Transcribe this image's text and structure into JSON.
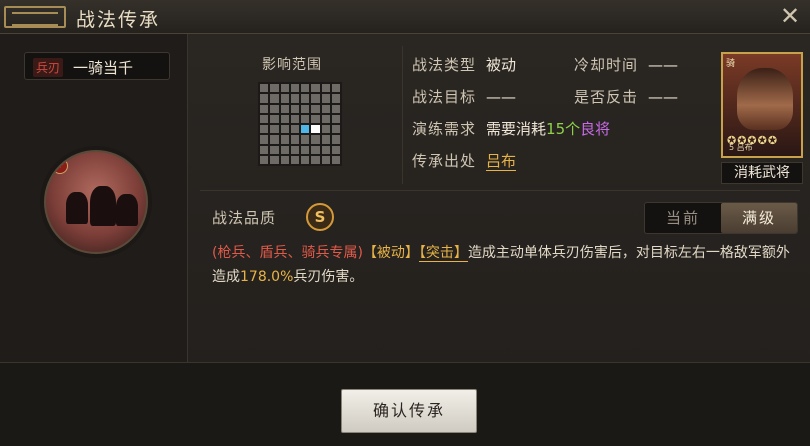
{
  "window": {
    "title": "战法传承",
    "close_glyph": "✕"
  },
  "skill": {
    "type_badge": "兵刃",
    "name": "一骑当千"
  },
  "range": {
    "label": "影响范围",
    "grid_rows": 8,
    "grid_cols": 8,
    "self_cell": [
      4,
      5
    ],
    "hit_cells": [
      [
        4,
        4
      ]
    ]
  },
  "info": {
    "type_label": "战法类型",
    "type_value": "被动",
    "cooldown_label": "冷却时间",
    "cooldown_value": "——",
    "target_label": "战法目标",
    "target_value": "——",
    "counter_label": "是否反击",
    "counter_value": "——",
    "train_label": "演练需求",
    "train_prefix": "需要消耗",
    "train_count": "15个",
    "train_item": "良将",
    "origin_label": "传承出处",
    "origin_value": "吕布"
  },
  "card": {
    "caption": "消耗武将",
    "stars": "✪✪✪✪✪",
    "corner_text": "骑",
    "mini_text": "5   吕布"
  },
  "quality": {
    "label": "战法品质",
    "grade": "S"
  },
  "toggle": {
    "current_label": "当前",
    "max_label": "满级",
    "selected": "max"
  },
  "description": {
    "restriction": "(枪兵、盾兵、骑兵专属)",
    "tag_passive": "【被动】",
    "tag_burst": "【突击】",
    "text_1": "造成主动单体兵刃伤害后，对目标左右一格敌军额外造成",
    "value": "178.0%",
    "text_2": "兵刃伤害。"
  },
  "footer": {
    "confirm_label": "确认传承"
  },
  "colors": {
    "accent_gold": "#e7b347",
    "accent_red": "#e05a4a",
    "accent_green": "#8fd14a",
    "accent_purple": "#c96be8",
    "grid_hit": "#4fb7e8"
  }
}
